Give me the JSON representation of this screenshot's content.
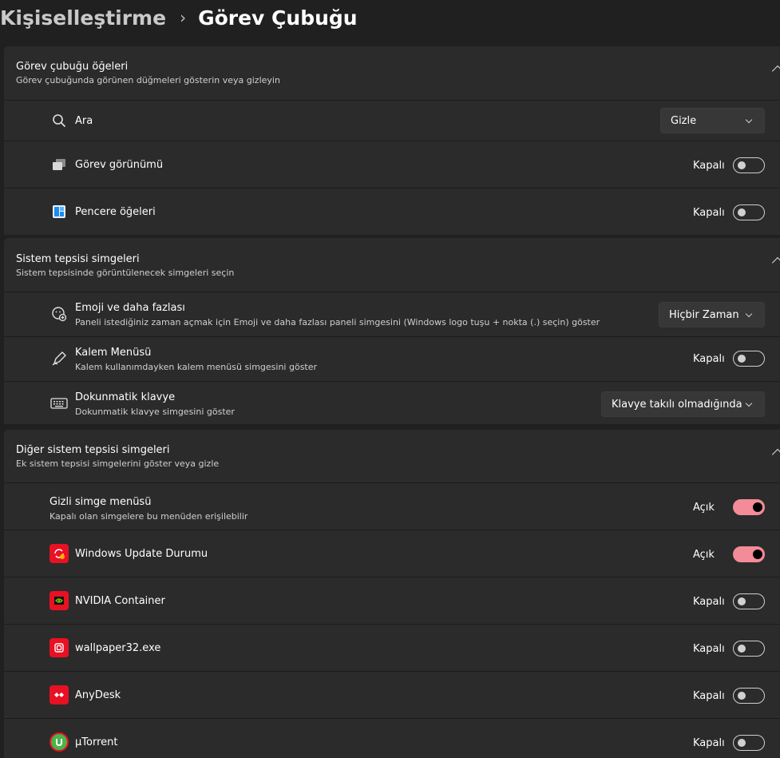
{
  "breadcrumb": {
    "parent": "Kişiselleştirme",
    "separator": "›",
    "current": "Görev Çubuğu"
  },
  "sections": [
    {
      "title": "Görev çubuğu öğeleri",
      "subtitle": "Görev çubuğunda görünen düğmeleri gösterin veya gizleyin",
      "rows": [
        {
          "label": "Ara",
          "dropdown": "Gizle"
        },
        {
          "label": "Görev görünümü",
          "state": "Kapalı"
        },
        {
          "label": "Pencere öğeleri",
          "state": "Kapalı"
        }
      ]
    },
    {
      "title": "Sistem tepsisi simgeleri",
      "subtitle": "Sistem tepsisinde görüntülenecek simgeleri seçin",
      "rows": [
        {
          "label": "Emoji ve daha fazlası",
          "desc": "Paneli istediğiniz zaman açmak için Emoji ve daha fazlası paneli simgesini (Windows logo tuşu + nokta (.) seçin) göster",
          "dropdown": "Hiçbir Zaman"
        },
        {
          "label": "Kalem Menüsü",
          "desc": "Kalem kullanımdayken kalem menüsü simgesini göster",
          "state": "Kapalı"
        },
        {
          "label": "Dokunmatik klavye",
          "desc": "Dokunmatik klavye simgesini göster",
          "dropdown": "Klavye takılı olmadığında"
        }
      ]
    },
    {
      "title": "Diğer sistem tepsisi simgeleri",
      "subtitle": "Ek sistem tepsisi simgelerini göster veya gizle",
      "rows": [
        {
          "label": "Gizli simge menüsü",
          "desc": "Kapalı olan simgelere bu menüden erişilebilir",
          "state": "Açık"
        },
        {
          "label": "Windows Update Durumu",
          "state": "Açık"
        },
        {
          "label": "NVIDIA Container",
          "state": "Kapalı"
        },
        {
          "label": "wallpaper32.exe",
          "state": "Kapalı"
        },
        {
          "label": "AnyDesk",
          "state": "Kapalı"
        },
        {
          "label": "µTorrent",
          "state": "Kapalı"
        }
      ]
    }
  ],
  "colors": {
    "background": "#202020",
    "card": "#2b2b2b",
    "accent": "#f48b98",
    "app_badge": "#e81123"
  }
}
